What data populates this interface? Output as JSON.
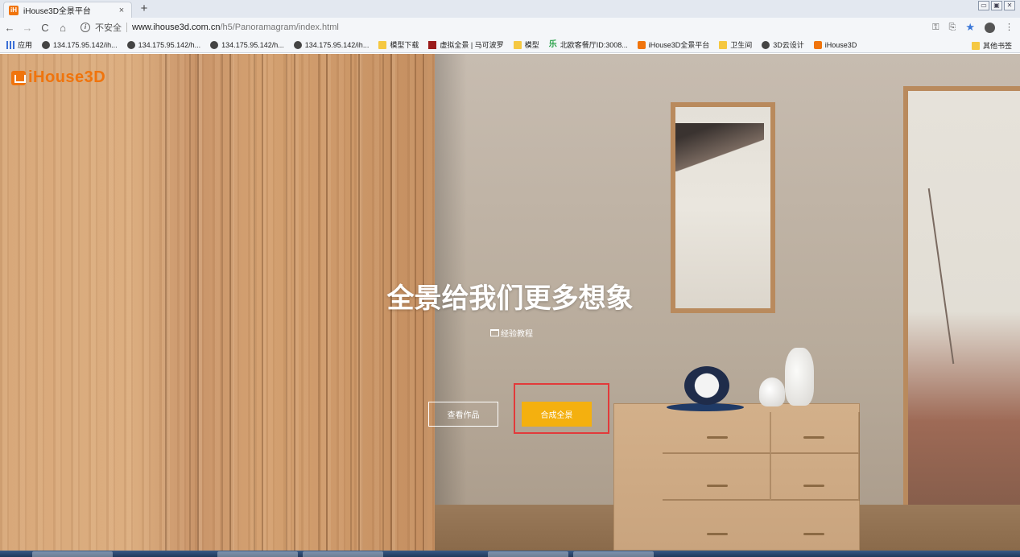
{
  "browser": {
    "tab": {
      "favicon": "iH",
      "title": "iHouse3D全景平台",
      "close": "×"
    },
    "new_tab": "+",
    "window_controls": [
      "▭",
      "▣",
      "✕"
    ],
    "nav": {
      "back": "←",
      "forward": "→",
      "reload": "C",
      "home": "⌂"
    },
    "address": {
      "info_icon": "i",
      "security": "不安全",
      "host": "www.ihouse3d.com.cn",
      "path": "/h5/Panoramagram/index.html"
    },
    "toolbar_icons": [
      "key-icon",
      "translate-icon",
      "star-icon",
      "account-icon",
      "menu-icon"
    ]
  },
  "bookmarks": [
    {
      "icon": "apps",
      "label": "应用"
    },
    {
      "icon": "globe",
      "label": "134.175.95.142/ih..."
    },
    {
      "icon": "globe",
      "label": "134.175.95.142/h..."
    },
    {
      "icon": "globe",
      "label": "134.175.95.142/h..."
    },
    {
      "icon": "globe",
      "label": "134.175.95.142/ih..."
    },
    {
      "icon": "folder",
      "label": "模型下载"
    },
    {
      "icon": "red",
      "label": "虚拟全景 | 马可波罗"
    },
    {
      "icon": "folder",
      "label": "模型"
    },
    {
      "icon": "green",
      "label": "北欧客餐厅ID:3008..."
    },
    {
      "icon": "orange",
      "label": "iHouse3D全景平台"
    },
    {
      "icon": "folder",
      "label": "卫生间"
    },
    {
      "icon": "globe",
      "label": "3D云设计"
    },
    {
      "icon": "orange",
      "label": "iHouse3D"
    }
  ],
  "other_bookmarks": "其他书签",
  "page": {
    "logo": "iHouse3D",
    "headline": "全景给我们更多想象",
    "tutorial_link": "经验教程",
    "view_works_button": "查看作品",
    "compose_panorama_button": "合成全景",
    "colors": {
      "brand": "#f0740c",
      "primary_button": "#f4b00f",
      "highlight": "#e23a3a"
    }
  }
}
